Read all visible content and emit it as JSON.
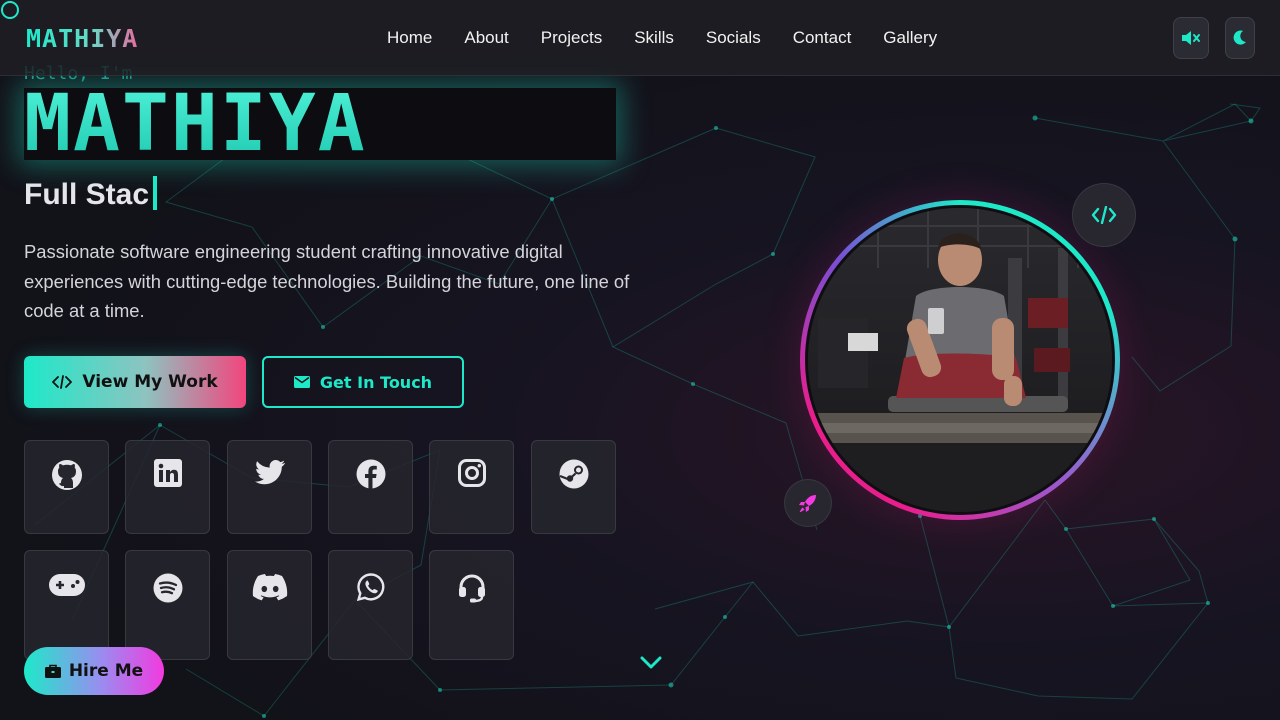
{
  "navbar": {
    "logo": "MATHIYA",
    "links": [
      "Home",
      "About",
      "Projects",
      "Skills",
      "Socials",
      "Contact",
      "Gallery"
    ],
    "sound_icon": "volume-mute-icon",
    "theme_icon": "moon-icon"
  },
  "hero": {
    "greeting": "Hello, I'm",
    "name": "MATHIYA",
    "role_typed": "Full Stac",
    "description": "Passionate software engineering student crafting innovative digital experiences with cutting-edge technologies. Building the future, one line of code at a time.",
    "primary_button": "View My Work",
    "secondary_button": "Get In Touch"
  },
  "socials": [
    {
      "name": "github",
      "icon": "github-icon"
    },
    {
      "name": "linkedin",
      "icon": "linkedin-icon"
    },
    {
      "name": "twitter",
      "icon": "twitter-icon"
    },
    {
      "name": "facebook",
      "icon": "facebook-icon"
    },
    {
      "name": "instagram",
      "icon": "instagram-icon"
    },
    {
      "name": "steam",
      "icon": "steam-icon"
    },
    {
      "name": "gaming",
      "icon": "gamepad-icon"
    },
    {
      "name": "spotify",
      "icon": "spotify-icon"
    },
    {
      "name": "discord",
      "icon": "discord-icon"
    },
    {
      "name": "whatsapp",
      "icon": "whatsapp-icon"
    },
    {
      "name": "support",
      "icon": "headset-icon"
    }
  ],
  "hire_button": "Hire Me",
  "colors": {
    "accent": "#1de9c9",
    "pink": "#e91e8c",
    "background": "#121219"
  }
}
